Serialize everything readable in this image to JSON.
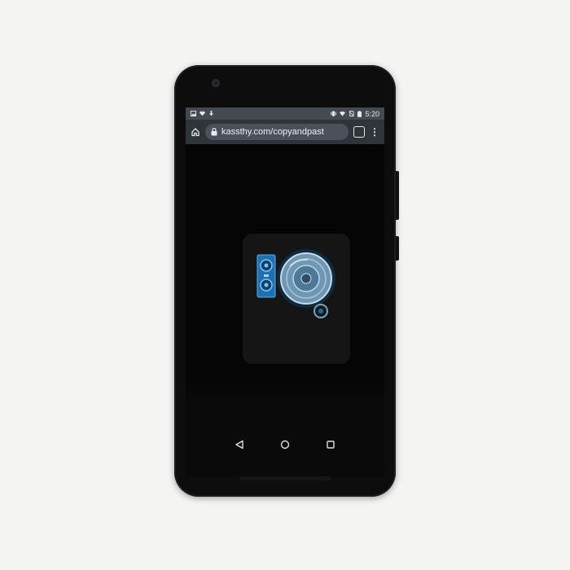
{
  "status_bar": {
    "time": "5:20",
    "left_icons": [
      "image-icon",
      "heart-icon",
      "download-icon"
    ],
    "right_icons": [
      "vibrate-icon",
      "wifi-icon",
      "no-sim-icon",
      "battery-icon"
    ]
  },
  "browser": {
    "url": "kassthy.com/copyandpast",
    "tab_count": "",
    "home_icon": "home-icon",
    "lock_icon": "lock-icon",
    "menu_icon": "more-vert-icon"
  },
  "app_content": {
    "icon": "speaker-spinning-icon",
    "colors": {
      "accent": "#2e8bd6",
      "disc": "#8fb4cc"
    }
  },
  "nav_bar": {
    "back_icon": "back-triangle-icon",
    "home_icon": "home-circle-icon",
    "recents_icon": "recents-square-icon"
  }
}
